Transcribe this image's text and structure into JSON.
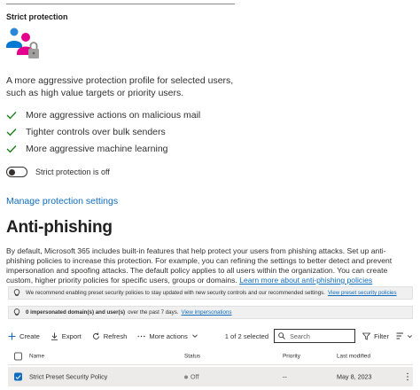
{
  "strict_card": {
    "title": "Strict protection",
    "description": "A more aggressive protection profile for selected users, such as high value targets or priority users.",
    "features": [
      "More aggressive actions on malicious mail",
      "Tighter controls over bulk senders",
      "More aggressive machine learning"
    ],
    "toggle_label": "Strict protection is off",
    "toggle_on": false,
    "manage_link": "Manage protection settings"
  },
  "anti_phishing": {
    "title": "Anti-phishing",
    "description": "By default, Microsoft 365 includes built-in features that help protect your users from phishing attacks. Set up anti-phishing policies to increase this protection. For example, you can refining the settings to better detect and prevent impersonation and spoofing attacks. The default policy applies to all users within the organization. You can create custom, higher priority policies for specific users, groups or domains.",
    "learn_more_link": "Learn more about anti-phishing policies"
  },
  "banners": {
    "recommend_text": "We recommend enabling preset security policies to stay updated with new security controls and our recommended settings.",
    "recommend_link": "View preset security policies",
    "impersonation_count": "0 impersonated domain(s) and user(s)",
    "impersonation_text": "over the past 7 days.",
    "impersonation_link": "View impersonations"
  },
  "toolbar": {
    "create_label": "Create",
    "export_label": "Export",
    "refresh_label": "Refresh",
    "more_actions_label": "More actions",
    "selected_count": "1 of 2 selected",
    "search_placeholder": "Search",
    "filter_label": "Filter"
  },
  "table": {
    "columns": [
      "Name",
      "Status",
      "Priority",
      "Last modified"
    ],
    "rows": [
      {
        "selected": true,
        "name": "Strict Preset Security Policy",
        "status": "Off",
        "priority": "--",
        "last_modified": "May 8, 2023"
      }
    ]
  },
  "colors": {
    "accent": "#0f6cbd",
    "check_green": "#107c10",
    "banner_bg": "#f0f0f0",
    "selected_row_bg": "#edebe9"
  }
}
